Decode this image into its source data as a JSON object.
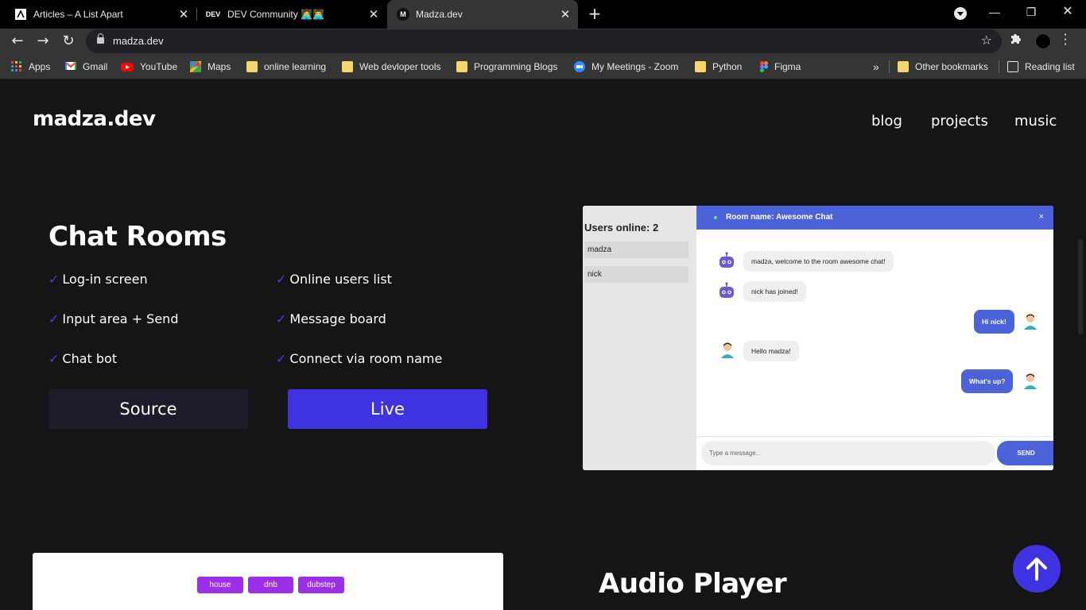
{
  "browser": {
    "tabs": [
      {
        "title": "Articles – A List Apart",
        "active": false
      },
      {
        "title": "DEV Community 👩‍💻👨‍💻",
        "active": false,
        "favicon_text": "DEV"
      },
      {
        "title": "Madza.dev",
        "active": true,
        "favicon_text": "M"
      }
    ],
    "url": "madza.dev",
    "bookmarks": [
      {
        "label": "Apps",
        "icon": "apps-grid-icon"
      },
      {
        "label": "Gmail",
        "icon": "gmail-icon"
      },
      {
        "label": "YouTube",
        "icon": "youtube-icon"
      },
      {
        "label": "Maps",
        "icon": "maps-icon"
      },
      {
        "label": "online learning",
        "icon": "folder-icon"
      },
      {
        "label": "Web devloper tools",
        "icon": "folder-icon"
      },
      {
        "label": "Programming Blogs",
        "icon": "folder-icon"
      },
      {
        "label": "My Meetings - Zoom",
        "icon": "zoom-icon"
      },
      {
        "label": "Python",
        "icon": "folder-icon"
      },
      {
        "label": "Figma",
        "icon": "figma-icon"
      }
    ],
    "bookmarks_overflow": "»",
    "other_bookmarks": "Other bookmarks",
    "reading_list": "Reading list"
  },
  "site": {
    "logo": "madza.dev",
    "nav": [
      "blog",
      "projects",
      "music"
    ]
  },
  "project": {
    "title": "Chat Rooms",
    "check_mark": "✓",
    "features": [
      "Log-in screen",
      "Online users list",
      "Input area + Send",
      "Message board",
      "Chat bot",
      "Connect via room name"
    ],
    "source_label": "Source",
    "live_label": "Live"
  },
  "chat_preview": {
    "users_online": "Users online: 2",
    "users": [
      "madza",
      "nick"
    ],
    "room_name": "Room name: Awesome Chat",
    "close": "×",
    "messages": [
      {
        "text": "madza, welcome to the room awesome chat!",
        "from": "bot"
      },
      {
        "text": "nick has joined!",
        "from": "bot"
      },
      {
        "text": "Hi nick!",
        "from": "self"
      },
      {
        "text": "Hello madza!",
        "from": "other"
      },
      {
        "text": "What's up?",
        "from": "self"
      }
    ],
    "input_placeholder": "Type a message..",
    "send_label": "SEND"
  },
  "audio": {
    "tags": [
      "house",
      "dnb",
      "dubstep"
    ],
    "title": "Audio Player"
  },
  "colors": {
    "accent": "#3f32e0",
    "chat_blue": "#4b62d9",
    "tag_purple": "#9b30e8",
    "page_bg": "#151515"
  }
}
